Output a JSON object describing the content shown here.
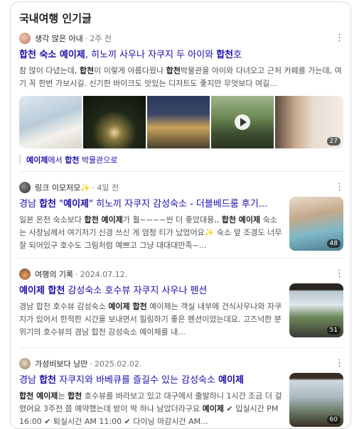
{
  "section": {
    "title": "국내여행 인기글"
  },
  "posts": [
    {
      "author": "생각 많은 아내",
      "date": "2주 전",
      "title": [
        {
          "t": "합천 숙소 예이제",
          "b": true
        },
        {
          "t": ", 히노끼 사우나 자쿠지 두 아이와 ",
          "b": false
        },
        {
          "t": "합천",
          "b": true
        },
        {
          "t": "호",
          "b": false
        }
      ],
      "snippet": [
        {
          "t": "참 많이 다녔는데, ",
          "b": false
        },
        {
          "t": "합천",
          "b": true
        },
        {
          "t": "이 이렇게 아름다웠나 ",
          "b": false
        },
        {
          "t": "합천",
          "b": true
        },
        {
          "t": "박물관을 아이와 다녀오고 근처 카페를 가는데, 여기 꼭 한번 가보시길. 신기한 바이크도 맛있는 디저트도 좋지만 무엇보다 여길...",
          "b": false
        }
      ],
      "image_count": "27",
      "related": [
        {
          "t": "예이제",
          "b": true
        },
        {
          "t": "에서 ",
          "b": false
        },
        {
          "t": "합천",
          "b": true
        },
        {
          "t": " 박물관으로",
          "b": false
        }
      ]
    },
    {
      "author": "링크 이모저모✨",
      "date": "4일 전",
      "title": [
        {
          "t": "경남 ",
          "b": false
        },
        {
          "t": "합천",
          "b": true
        },
        {
          "t": " \"",
          "b": false
        },
        {
          "t": "예이제",
          "b": true
        },
        {
          "t": "\" 히노끼 자쿠지 감성숙소 - 더블베드룸 후기...",
          "b": false
        }
      ],
      "snippet": [
        {
          "t": "일본 온천 숙소보다 ",
          "b": false
        },
        {
          "t": "합천 예이제",
          "b": true
        },
        {
          "t": "가 훨~~~~씬 더 좋았대용,, ",
          "b": false
        },
        {
          "t": "합천 예이제",
          "b": true
        },
        {
          "t": " 숙소는 사장님께서 여기저기 신경 쓰신 게 엄청 티가 났었어요✨ 숙소 앞 조경도 너무 잘 되어있구 호수도 그림처럼 예쁘고 그냥 대대대만족~...",
          "b": false
        }
      ],
      "image_count": "48"
    },
    {
      "author": "여행의 기록",
      "date": "2024.07.12.",
      "title": [
        {
          "t": "예이제 합천",
          "b": true
        },
        {
          "t": " 감성숙소 호수뷰 자쿠지 사우나 펜션",
          "b": false
        }
      ],
      "snippet": [
        {
          "t": "경남 합천 호수뷰 감성숙소 ",
          "b": false
        },
        {
          "t": "예이제 합천",
          "b": true
        },
        {
          "t": " 예이제는 객실 내부에 건식사우나와 자쿠지가 있어서 한적한 시간을 보내면서 힐링하기 좋은 펜션이었는데요. 고즈넉한 분위기의 호수뷰의 경남 합천 감성숙소 예이제를 내...",
          "b": false
        }
      ],
      "image_count": "51"
    },
    {
      "author": "가성비보다 낭만",
      "date": "2025.02.02.",
      "title": [
        {
          "t": "경남 ",
          "b": false
        },
        {
          "t": "합천",
          "b": true
        },
        {
          "t": " 자쿠지와 바베큐를 즐길수 있는 감성숙소 ",
          "b": false
        },
        {
          "t": "예이제",
          "b": true
        }
      ],
      "snippet": [
        {
          "t": "합천 예이제",
          "b": true
        },
        {
          "t": "는 ",
          "b": false
        },
        {
          "t": "합천",
          "b": true
        },
        {
          "t": " 호수뷰를 바라보고 있고 대구에서 출발하니 1시간 조금 더 걸렸어요 3주전 쯤 예약했는데 방이 딱 하나 남았더라구요 ",
          "b": false
        },
        {
          "t": "예이제",
          "b": true
        },
        {
          "t": " ✔ 입실시간 PM 16:00 ✔ 퇴실시간 AM 11:00 ✔ 다이닝 마감시간 AM...",
          "b": false
        }
      ],
      "image_count": "60"
    }
  ],
  "colors": {
    "link": "#1a0dab",
    "text": "#4d5156",
    "border": "#dadce0"
  },
  "icons": {
    "more": "vertical-ellipsis-icon",
    "play": "play-icon"
  },
  "glyphs": {
    "more": "⋮",
    "dot": "·"
  }
}
